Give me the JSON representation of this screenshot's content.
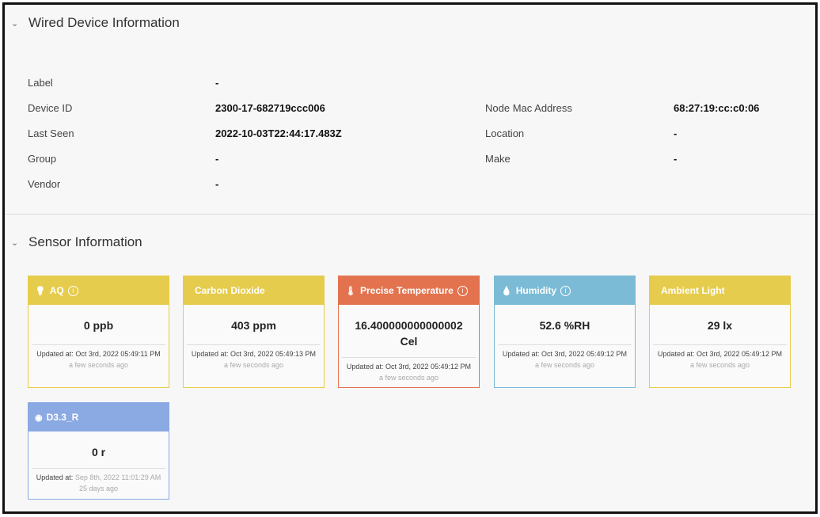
{
  "wired": {
    "title": "Wired Device Information",
    "fields": [
      {
        "label": "Label",
        "value": "-"
      },
      {
        "label": "Device ID",
        "value": "2300-17-682719ccc006"
      },
      {
        "label": "Last Seen",
        "value": "2022-10-03T22:44:17.483Z"
      },
      {
        "label": "Group",
        "value": "-"
      },
      {
        "label": "Vendor",
        "value": "-"
      },
      {
        "label": "Node Mac Address",
        "value": "68:27:19:cc:c0:06"
      },
      {
        "label": "Location",
        "value": "-"
      },
      {
        "label": "Make",
        "value": "-"
      }
    ]
  },
  "sensor": {
    "title": "Sensor Information",
    "updated_prefix": "Updated at:",
    "cards": [
      {
        "name": "AQ",
        "value": "0 ppb",
        "updated": "Oct 3rd, 2022 05:49:11 PM",
        "ago": "a few seconds ago",
        "color": "#e6cc4c",
        "icon": "bulb-icon"
      },
      {
        "name": "Carbon Dioxide",
        "value": "403 ppm",
        "updated": "Oct 3rd, 2022 05:49:13 PM",
        "ago": "a few seconds ago",
        "color": "#e6cc4c",
        "icon": ""
      },
      {
        "name": "Precise Temperature",
        "value": "16.400000000000002 Cel",
        "updated": "Oct 3rd, 2022 05:49:12 PM",
        "ago": "a few seconds ago",
        "color": "#e3734f",
        "icon": "thermometer-icon"
      },
      {
        "name": "Humidity",
        "value": "52.6 %RH",
        "updated": "Oct 3rd, 2022 05:49:12 PM",
        "ago": "a few seconds ago",
        "color": "#7bbbd6",
        "icon": "droplet-icon"
      },
      {
        "name": "Ambient Light",
        "value": "29 lx",
        "updated": "Oct 3rd, 2022 05:49:12 PM",
        "ago": "a few seconds ago",
        "color": "#e6cc4c",
        "icon": ""
      },
      {
        "name": "D3.3_R",
        "value": "0 r",
        "updated": "Sep 8th, 2022 11:01:29 AM",
        "ago": "25 days ago",
        "color": "#8ba9e2",
        "icon": "sensor-icon"
      }
    ]
  }
}
